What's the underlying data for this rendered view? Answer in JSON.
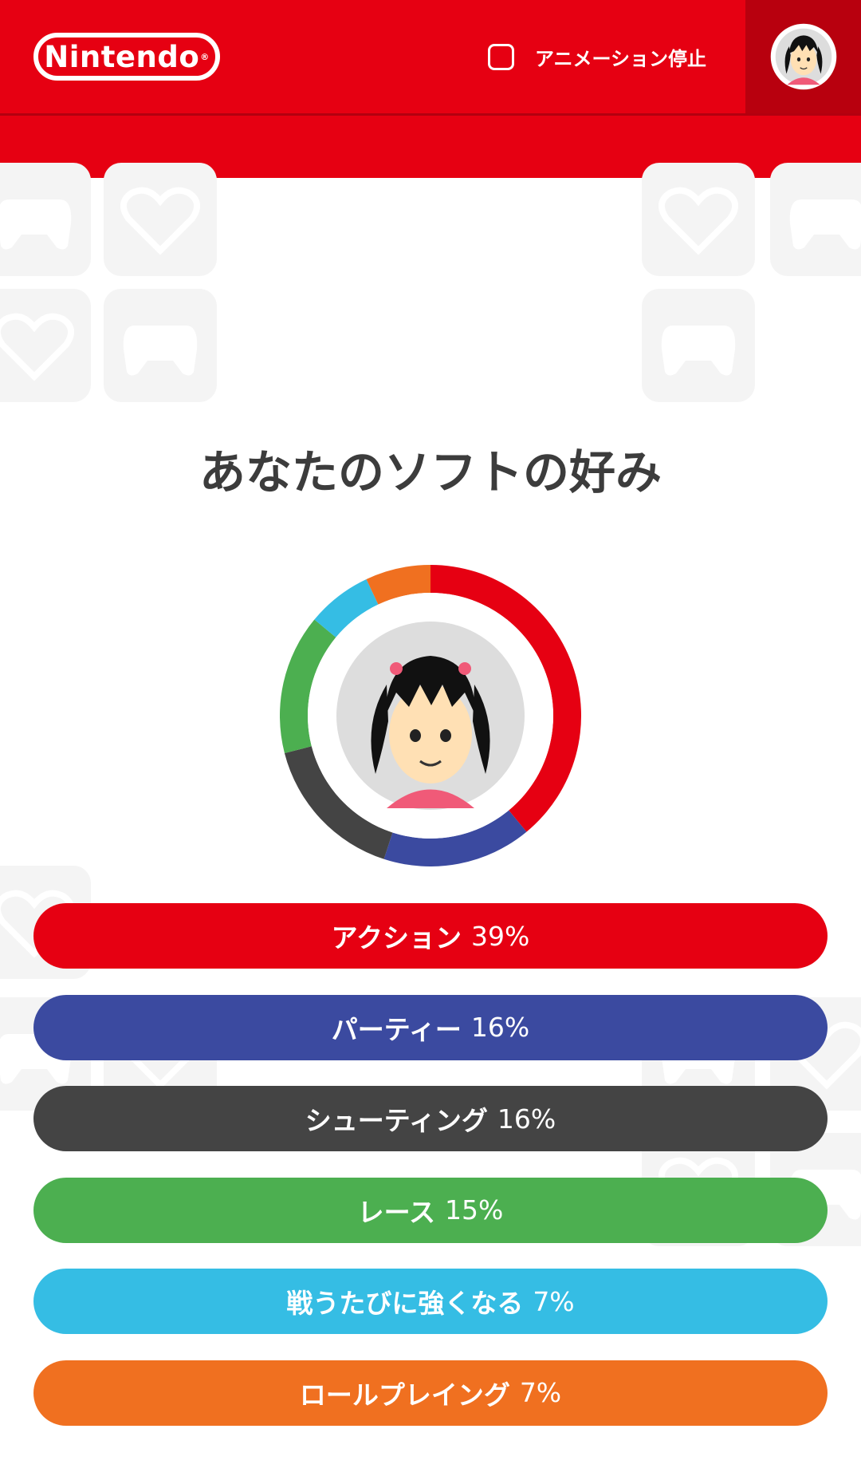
{
  "header": {
    "logo_text": "Nintendo",
    "logo_mark": "®",
    "animation_stop_label": "アニメーション停止",
    "animation_stop_checked": false,
    "avatar_icon": "mii-avatar-icon",
    "brand_color": "#e60012"
  },
  "main": {
    "title": "あなたのソフトの好み"
  },
  "chart_data": {
    "type": "pie",
    "categories": [
      "アクション",
      "パーティー",
      "シューティング",
      "レース",
      "戦うたびに強くなる",
      "ロールプレイング"
    ],
    "values": [
      39,
      16,
      16,
      15,
      7,
      7
    ],
    "colors": [
      "#e60012",
      "#3b4aa0",
      "#444444",
      "#4caf50",
      "#35bde4",
      "#f07020"
    ],
    "unit": "%"
  },
  "genres": [
    {
      "label": "アクション",
      "percent": "39%",
      "color": "#e60012"
    },
    {
      "label": "パーティー",
      "percent": "16%",
      "color": "#3b4aa0"
    },
    {
      "label": "シューティング",
      "percent": "16%",
      "color": "#444444"
    },
    {
      "label": "レース",
      "percent": "15%",
      "color": "#4caf50"
    },
    {
      "label": "戦うたびに強くなる",
      "percent": "7%",
      "color": "#35bde4"
    },
    {
      "label": "ロールプレイング",
      "percent": "7%",
      "color": "#f07020"
    }
  ],
  "decor": {
    "tile_icons": [
      "controller-icon",
      "heart-icon"
    ]
  }
}
